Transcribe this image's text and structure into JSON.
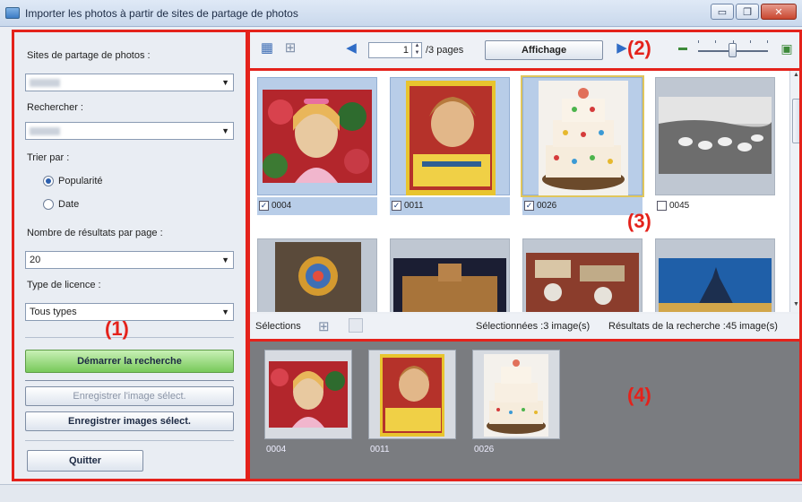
{
  "window": {
    "title": "Importer les photos à partir de sites de partage de photos",
    "min": "▭",
    "max": "❐",
    "close": "✕"
  },
  "left": {
    "sites_label": "Sites de partage de photos :",
    "search_label": "Rechercher :",
    "sort_label": "Trier par :",
    "sort_options": [
      "Popularité",
      "Date"
    ],
    "sort_selected": "Popularité",
    "results_label": "Nombre de résultats par page :",
    "results_value": "20",
    "license_label": "Type de licence :",
    "license_value": "Tous types",
    "start_search": "Démarrer la recherche",
    "save_selected_image": "Enregistrer l'image sélect.",
    "save_selected_images": "Enregistrer images sélect.",
    "quit": "Quitter"
  },
  "toolbar": {
    "page": "1",
    "pages_text": "/3 pages",
    "display_button": "Affichage",
    "zoom_level": 0.5
  },
  "thumbnails": [
    {
      "id": "0004",
      "checked": true,
      "selected": true
    },
    {
      "id": "0011",
      "checked": true,
      "selected": true
    },
    {
      "id": "0026",
      "checked": true,
      "selected": true,
      "focused": true
    },
    {
      "id": "0045",
      "checked": false,
      "selected": false
    },
    {
      "id": "",
      "checked": false,
      "selected": false
    },
    {
      "id": "",
      "checked": false,
      "selected": false
    },
    {
      "id": "",
      "checked": false,
      "selected": false
    },
    {
      "id": "",
      "checked": false,
      "selected": false
    }
  ],
  "selection_bar": {
    "label": "Sélections",
    "selected_text": "Sélectionnées :3 image(s)",
    "results_text": "Résultats de la recherche :45 image(s)"
  },
  "tray": [
    {
      "id": "0004"
    },
    {
      "id": "0011"
    },
    {
      "id": "0026"
    }
  ],
  "callouts": {
    "c1": "(1)",
    "c2": "(2)",
    "c3": "(3)",
    "c4": "(4)"
  },
  "colors": {
    "callout_red": "#e4221b",
    "selected_blue": "#b8cde8",
    "start_green": "#78c95a"
  }
}
